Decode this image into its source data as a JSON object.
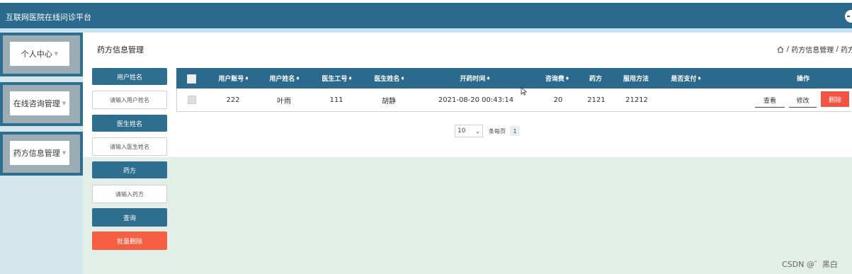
{
  "app": {
    "title": "互联网医院在线问诊平台"
  },
  "sidebar": {
    "items": [
      {
        "label": "个人中心"
      },
      {
        "label": "在线咨询管理"
      },
      {
        "label": "药方信息管理"
      }
    ]
  },
  "page": {
    "title": "药方信息管理",
    "breadcrumb": {
      "section": "药方信息管理",
      "current": "药方"
    }
  },
  "filters": {
    "user_name_label": "用户姓名",
    "user_name_placeholder": "请输入用户姓名",
    "doctor_name_label": "医生姓名",
    "doctor_name_placeholder": "请输入医生姓名",
    "prescription_label": "药方",
    "prescription_placeholder": "请输入药方",
    "query_button": "查询",
    "batch_delete_button": "批量删除"
  },
  "table": {
    "columns": [
      {
        "label": "用户账号",
        "sortable": true
      },
      {
        "label": "用户姓名",
        "sortable": true
      },
      {
        "label": "医生工号",
        "sortable": true
      },
      {
        "label": "医生姓名",
        "sortable": true
      },
      {
        "label": "开药时间",
        "sortable": true
      },
      {
        "label": "咨询费",
        "sortable": true
      },
      {
        "label": "药方",
        "sortable": false
      },
      {
        "label": "服用方法",
        "sortable": false
      },
      {
        "label": "是否支付",
        "sortable": true
      },
      {
        "label": "操作",
        "sortable": false
      }
    ],
    "sort_glyph": "♦",
    "rows": [
      {
        "user_account": "222",
        "user_name": "叶雨",
        "doctor_no": "111",
        "doctor_name": "胡静",
        "time": "2021-08-20 00:43:14",
        "fee": "20",
        "prescription": "2121",
        "usage": "21212",
        "paid": "",
        "actions": {
          "view": "查看",
          "edit": "修改",
          "delete": "删除"
        }
      }
    ]
  },
  "pagination": {
    "page_size": "10",
    "per_page_label": "条每页",
    "current_page": "1"
  },
  "watermark": "CSDN @゛黑白",
  "colors": {
    "primary": "#2b6a8c",
    "danger": "#f3533f",
    "accent": "#f55e40",
    "sidebar_bg": "#d3e6eb"
  }
}
